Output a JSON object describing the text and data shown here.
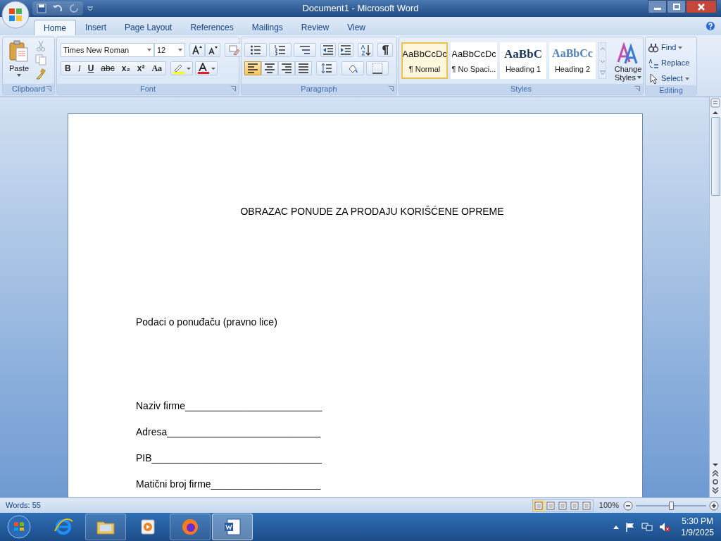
{
  "window": {
    "title": "Document1 - Microsoft Word"
  },
  "tabs": [
    {
      "label": "Home",
      "selected": true
    },
    {
      "label": "Insert",
      "selected": false
    },
    {
      "label": "Page Layout",
      "selected": false
    },
    {
      "label": "References",
      "selected": false
    },
    {
      "label": "Mailings",
      "selected": false
    },
    {
      "label": "Review",
      "selected": false
    },
    {
      "label": "View",
      "selected": false
    }
  ],
  "ribbon": {
    "clipboard": {
      "label": "Clipboard",
      "paste_label": "Paste"
    },
    "font": {
      "label": "Font",
      "font_name": "Times New Roman",
      "font_size": "12",
      "format_buttons": [
        {
          "kind": "bold",
          "label": "B"
        },
        {
          "kind": "italic",
          "label": "I"
        },
        {
          "kind": "underline",
          "label": "U"
        },
        {
          "kind": "strike",
          "label": "abc"
        },
        {
          "kind": "sub",
          "label": "x₂"
        },
        {
          "kind": "sup",
          "label": "x²"
        },
        {
          "kind": "case",
          "label": "Aa"
        }
      ]
    },
    "paragraph": {
      "label": "Paragraph",
      "align_buttons": [
        {
          "kind": "left",
          "selected": true
        },
        {
          "kind": "center",
          "selected": false
        },
        {
          "kind": "right",
          "selected": false
        },
        {
          "kind": "justify",
          "selected": false
        }
      ]
    },
    "styles": {
      "label": "Styles",
      "items": [
        {
          "kind": "body",
          "preview": "AaBbCcDc",
          "name": "¶ Normal",
          "selected": true
        },
        {
          "kind": "body",
          "preview": "AaBbCcDc",
          "name": "¶ No Spaci...",
          "selected": false
        },
        {
          "kind": "heading1",
          "preview": "AaBbC",
          "name": "Heading 1",
          "selected": false
        },
        {
          "kind": "heading2",
          "preview": "AaBbCc",
          "name": "Heading 2",
          "selected": false
        }
      ],
      "change_styles": [
        "Change",
        "Styles"
      ]
    },
    "editing": {
      "label": "Editing",
      "items": [
        {
          "kind": "find",
          "label": "Find"
        },
        {
          "kind": "replace",
          "label": "Replace"
        },
        {
          "kind": "select",
          "label": "Select"
        }
      ]
    }
  },
  "document": {
    "lines": [
      {
        "kind": "title",
        "text": "OBRAZAC PONUDE ZA PRODAJU KORIŠĆENE OPREME"
      },
      {
        "kind": "paragraph",
        "text": "Podaci o ponuđaču (pravno lice)"
      },
      {
        "kind": "field",
        "text": "Naziv firme_________________________"
      },
      {
        "kind": "field",
        "text": "Adresa____________________________"
      },
      {
        "kind": "field",
        "text": "PIB_______________________________"
      },
      {
        "kind": "field",
        "text": "Matični broj firme____________________"
      }
    ]
  },
  "status_bar": {
    "words": "Words: 55",
    "zoom": "100%",
    "zoom_slider": {
      "level": 0.5
    }
  },
  "taskbar": {
    "apps": [
      {
        "kind": "browser",
        "selected": false
      },
      {
        "kind": "folder",
        "selected": false
      },
      {
        "kind": "media",
        "selected": false
      },
      {
        "kind": "firefox",
        "selected": false
      },
      {
        "kind": "word",
        "selected": true
      }
    ],
    "time": "5:30 PM",
    "date": "1/9/2025"
  }
}
